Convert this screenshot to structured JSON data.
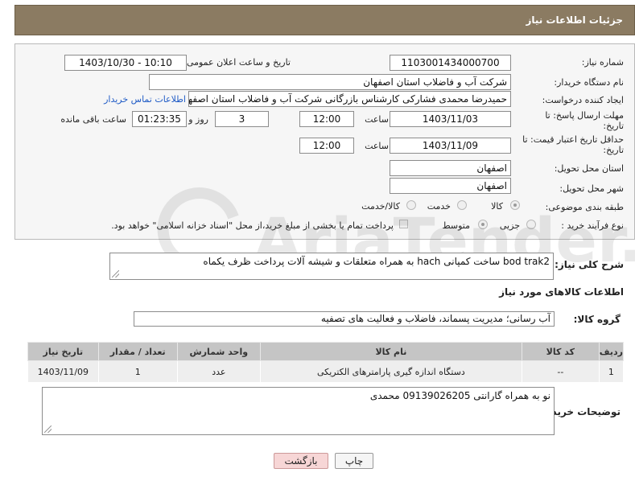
{
  "header": {
    "title": "جزئیات اطلاعات نیاز"
  },
  "form": {
    "need_number": {
      "label": "شماره نیاز:",
      "value": "1103001434000700"
    },
    "announce": {
      "label": "تاریخ و ساعت اعلان عمومی:",
      "value": "1403/10/30 - 10:10"
    },
    "buyer_org": {
      "label": "نام دستگاه خریدار:",
      "value": "شرکت آب و فاضلاب استان اصفهان"
    },
    "requester": {
      "label": "ایجاد کننده درخواست:",
      "value": "حمیدرضا محمدی فشارکی کارشناس بازرگانی شرکت آب و فاضلاب استان اصفهان",
      "contact_link": "اطلاعات تماس خریدار"
    },
    "reply_deadline": {
      "label_line1": "مهلت ارسال پاسخ: تا",
      "label_line2": "تاریخ:",
      "date": "1403/11/03",
      "time_label": "ساعت",
      "time": "12:00",
      "days": "3",
      "days_label": "روز و",
      "remaining": "01:23:35",
      "remaining_label": "ساعت باقی مانده"
    },
    "price_validity": {
      "label_line1": "حداقل تاریخ اعتبار قیمت: تا",
      "label_line2": "تاریخ:",
      "date": "1403/11/09",
      "time_label": "ساعت",
      "time": "12:00"
    },
    "province": {
      "label": "استان محل تحویل:",
      "value": "اصفهان"
    },
    "city": {
      "label": "شهر محل تحویل:",
      "value": "اصفهان"
    },
    "category": {
      "label": "طبقه بندی موضوعی:",
      "options": [
        "کالا",
        "خدمت",
        "کالا/خدمت"
      ],
      "selected": "کالا"
    },
    "process": {
      "label": "نوع فرآیند خرید :",
      "options": [
        "جزیی",
        "متوسط"
      ],
      "selected": "متوسط",
      "payment_note": "پرداخت تمام یا بخشی از مبلغ خرید،از محل \"اسناد خزانه اسلامی\" خواهد بود."
    }
  },
  "description": {
    "label": "شرح کلی نیاز:",
    "value": "bod trak2   ساخت کمپانی hach به همراه متعلقات و شیشه آلات  پرداخت ظرف یکماه"
  },
  "goods_section": {
    "title": "اطلاعات کالاهای مورد نیاز",
    "group_label": "گروه کالا:",
    "group_value": "آب رسانی؛ مدیریت پسماند، فاضلاب و فعالیت های تصفیه"
  },
  "table": {
    "headers": [
      "ردیف",
      "کد کالا",
      "نام کالا",
      "واحد شمارش",
      "تعداد / مقدار",
      "تاریخ نیاز"
    ],
    "rows": [
      [
        "1",
        "--",
        "دستگاه اندازه گیری پارامترهای الکتریکی",
        "عدد",
        "1",
        "1403/11/09"
      ]
    ]
  },
  "buyer_notes": {
    "label": "توضیحات خریدار:",
    "value": "نو به همراه گارانتی 09139026205 محمدی"
  },
  "buttons": {
    "print": "چاپ",
    "back": "بازگشت"
  },
  "watermark": {
    "text": "AriaTender.net"
  },
  "colors": {
    "header_bg": "#8b7b62",
    "link": "#1f5bc6",
    "back_button_bg": "#f7d6d6"
  }
}
